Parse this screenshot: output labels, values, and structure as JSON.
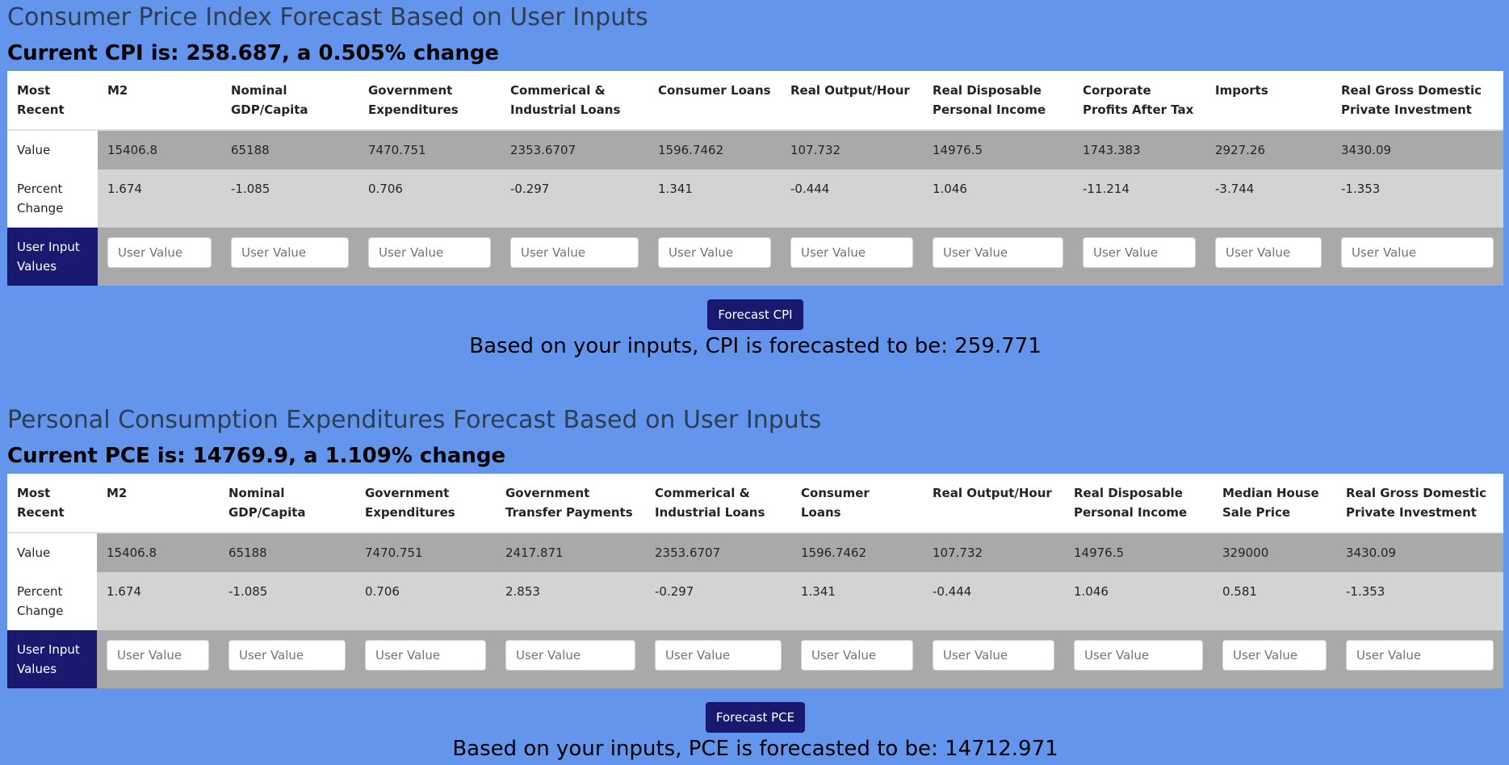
{
  "cpi": {
    "title": "Consumer Price Index Forecast Based on User Inputs",
    "current": "Current CPI is: 258.687, a 0.505% change",
    "row_labels": {
      "header": "Most Recent",
      "value": "Value",
      "percent": "Percent Change",
      "input": "User Input Values"
    },
    "columns": [
      {
        "header": "M2",
        "value": "15406.8",
        "percent": "1.674"
      },
      {
        "header": "Nominal GDP/Capita",
        "value": "65188",
        "percent": "-1.085"
      },
      {
        "header": "Government Expenditures",
        "value": "7470.751",
        "percent": "0.706"
      },
      {
        "header": "Commerical & Industrial Loans",
        "value": "2353.6707",
        "percent": "-0.297"
      },
      {
        "header": "Consumer Loans",
        "value": "1596.7462",
        "percent": "1.341"
      },
      {
        "header": "Real Output/Hour",
        "value": "107.732",
        "percent": "-0.444"
      },
      {
        "header": "Real Disposable Personal Income",
        "value": "14976.5",
        "percent": "1.046"
      },
      {
        "header": "Corporate Profits After Tax",
        "value": "1743.383",
        "percent": "-11.214"
      },
      {
        "header": "Imports",
        "value": "2927.26",
        "percent": "-3.744"
      },
      {
        "header": "Real Gross Domestic Private Investment",
        "value": "3430.09",
        "percent": "-1.353"
      }
    ],
    "input_placeholder": "User Value",
    "button_label": "Forecast CPI",
    "result": "Based on your inputs, CPI is forecasted to be: 259.771"
  },
  "pce": {
    "title": "Personal Consumption Expenditures Forecast Based on User Inputs",
    "current": "Current PCE is: 14769.9, a 1.109% change",
    "row_labels": {
      "header": "Most Recent",
      "value": "Value",
      "percent": "Percent Change",
      "input": "User Input Values"
    },
    "columns": [
      {
        "header": "M2",
        "value": "15406.8",
        "percent": "1.674"
      },
      {
        "header": "Nominal GDP/Capita",
        "value": "65188",
        "percent": "-1.085"
      },
      {
        "header": "Government Expenditures",
        "value": "7470.751",
        "percent": "0.706"
      },
      {
        "header": "Government Transfer Payments",
        "value": "2417.871",
        "percent": "2.853"
      },
      {
        "header": "Commerical & Industrial Loans",
        "value": "2353.6707",
        "percent": "-0.297"
      },
      {
        "header": "Consumer Loans",
        "value": "1596.7462",
        "percent": "1.341"
      },
      {
        "header": "Real Output/Hour",
        "value": "107.732",
        "percent": "-0.444"
      },
      {
        "header": "Real Disposable Personal Income",
        "value": "14976.5",
        "percent": "1.046"
      },
      {
        "header": "Median House Sale Price",
        "value": "329000",
        "percent": "0.581"
      },
      {
        "header": "Real Gross Domestic Private Investment",
        "value": "3430.09",
        "percent": "-1.353"
      }
    ],
    "input_placeholder": "User Value",
    "button_label": "Forecast PCE",
    "result": "Based on your inputs, PCE is forecasted to be: 14712.971"
  },
  "colors": {
    "page_background": "#6495ED",
    "value_row": "#A9A9A9",
    "percent_row": "#D3D3D3",
    "accent_navy": "#191970",
    "title_text": "#2d3e53"
  }
}
